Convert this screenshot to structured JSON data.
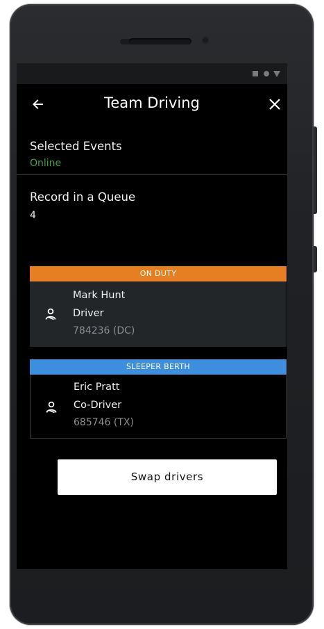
{
  "header": {
    "title": "Team Driving"
  },
  "selected_events": {
    "label": "Selected Events",
    "status": "Online"
  },
  "record_queue": {
    "label": "Record in a Queue",
    "count": "4"
  },
  "cards": [
    {
      "status": "ON DUTY",
      "name": "Mark Hunt",
      "role": "Driver",
      "id": "784236 (DC)",
      "status_color": "#e67e22"
    },
    {
      "status": "SLEEPER BERTH",
      "name": "Eric Pratt",
      "role": "Co-Driver",
      "id": "685746 (TX)",
      "status_color": "#3e8ede"
    }
  ],
  "actions": {
    "swap_label": "Swap drivers"
  },
  "icons": {
    "back": "arrow-left-icon",
    "close": "close-icon",
    "person": "person-icon",
    "status": [
      "square-icon",
      "circle-icon",
      "triangle-icon"
    ]
  },
  "colors": {
    "online": "#43a047",
    "background": "#000000",
    "button": "#ffffff"
  }
}
